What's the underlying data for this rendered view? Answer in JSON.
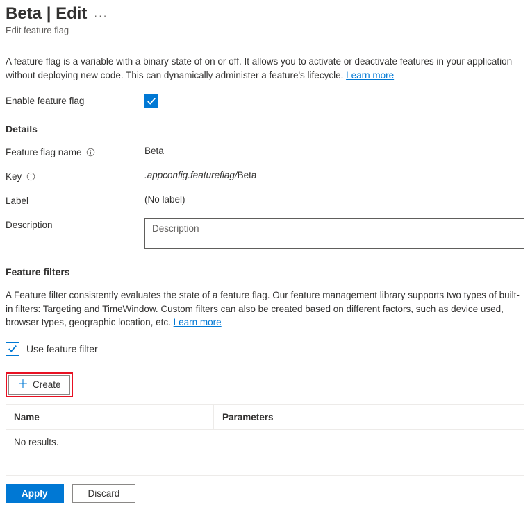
{
  "header": {
    "title": "Beta | Edit",
    "subtitle": "Edit feature flag",
    "moreIconName": "more-icon"
  },
  "intro": {
    "text": "A feature flag is a variable with a binary state of on or off. It allows you to activate or deactivate features in your application without deploying new code. This can dynamically administer a feature's lifecycle. ",
    "learnMore": "Learn more"
  },
  "enableRow": {
    "label": "Enable feature flag",
    "checked": true
  },
  "details": {
    "sectionTitle": "Details",
    "nameLabel": "Feature flag name",
    "nameValue": "Beta",
    "keyLabel": "Key",
    "keyPrefix": ".appconfig.featureflag/",
    "keySuffix": "Beta",
    "labelLabel": "Label",
    "labelValue": "(No label)",
    "descriptionLabel": "Description",
    "descriptionPlaceholder": "Description",
    "descriptionValue": ""
  },
  "filters": {
    "sectionTitle": "Feature filters",
    "intro": "A Feature filter consistently evaluates the state of a feature flag. Our feature management library supports two types of built-in filters: Targeting and TimeWindow. Custom filters can also be created based on different factors, such as device used, browser types, geographic location, etc. ",
    "learnMore": "Learn more",
    "useFilterLabel": "Use feature filter",
    "useFilterChecked": true,
    "createLabel": "Create",
    "table": {
      "colName": "Name",
      "colParams": "Parameters",
      "empty": "No results."
    }
  },
  "footer": {
    "apply": "Apply",
    "discard": "Discard"
  },
  "colors": {
    "primary": "#0078d4",
    "highlight": "#e81123"
  }
}
